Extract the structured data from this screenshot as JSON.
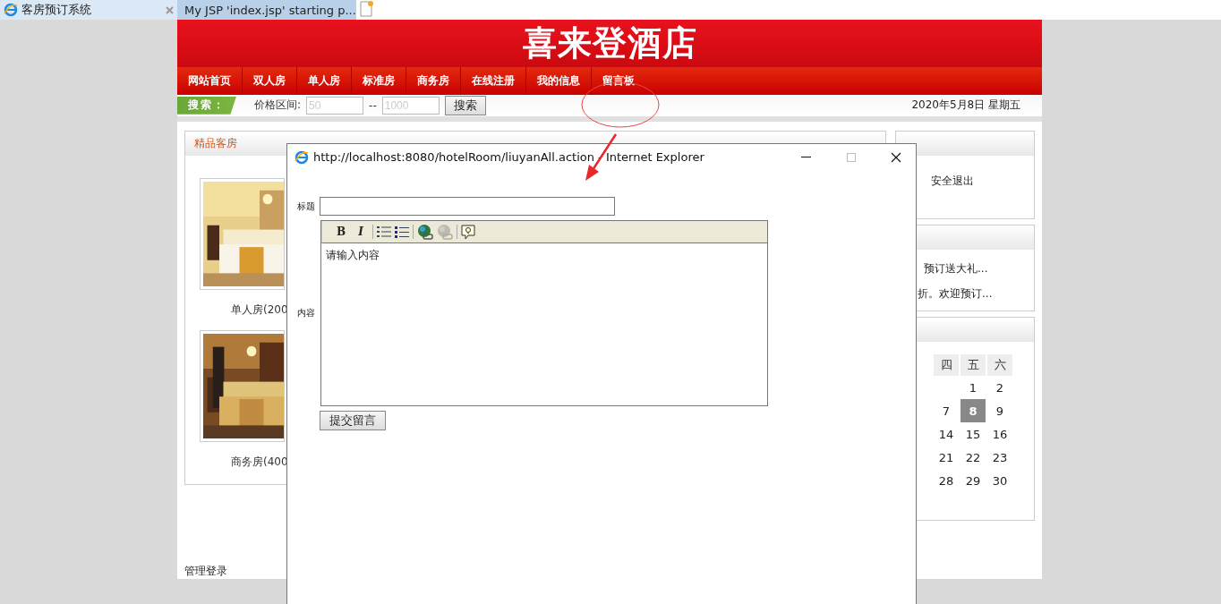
{
  "browser_tabs": [
    {
      "title": "客房预订系统",
      "selected": true
    },
    {
      "title": "My JSP 'index.jsp' starting p...",
      "selected": false
    }
  ],
  "header": {
    "title": "喜来登酒店"
  },
  "nav": [
    "网站首页",
    "双人房",
    "单人房",
    "标准房",
    "商务房",
    "在线注册",
    "我的信息",
    "留言板"
  ],
  "search": {
    "label": "搜索：",
    "price_label": "价格区间:",
    "min_placeholder": "50",
    "separator": "--",
    "max_placeholder": "1000",
    "button": "搜索"
  },
  "date": "2020年5月8日 星期五",
  "featured": {
    "title": "精品客房",
    "rooms": [
      {
        "caption": "单人房(200"
      },
      {
        "caption": "商务房(400"
      }
    ]
  },
  "account_box": {
    "link": "安全退出"
  },
  "news": [
    "预订送大礼...",
    "折。欢迎预订..."
  ],
  "calendar": {
    "weekdays": [
      "四",
      "五",
      "六"
    ],
    "weeks": [
      [
        {
          "kind": "blank"
        },
        {
          "kind": "day",
          "label": "1",
          "selected": false
        },
        {
          "kind": "day",
          "label": "2",
          "selected": false
        }
      ],
      [
        {
          "kind": "day",
          "label": "7",
          "selected": false
        },
        {
          "kind": "day",
          "label": "8",
          "selected": true
        },
        {
          "kind": "day",
          "label": "9",
          "selected": false
        }
      ],
      [
        {
          "kind": "day",
          "label": "14",
          "selected": false
        },
        {
          "kind": "day",
          "label": "15",
          "selected": false
        },
        {
          "kind": "day",
          "label": "16",
          "selected": false
        }
      ],
      [
        {
          "kind": "day",
          "label": "21",
          "selected": false
        },
        {
          "kind": "day",
          "label": "22",
          "selected": false
        },
        {
          "kind": "day",
          "label": "23",
          "selected": false
        }
      ],
      [
        {
          "kind": "day",
          "label": "28",
          "selected": false
        },
        {
          "kind": "day",
          "label": "29",
          "selected": false
        },
        {
          "kind": "day",
          "label": "30",
          "selected": false
        }
      ]
    ]
  },
  "admin_link": "管理登录",
  "popup": {
    "title": "http://localhost:8080/hotelRoom/liuyanAll.action - Internet Explorer",
    "title_label": "标题",
    "content_label": "内容",
    "toolbar": {
      "bold": "B",
      "italic": "I",
      "unlink_disabled": true
    },
    "content_value": "请输入内容",
    "submit": "提交留言"
  }
}
